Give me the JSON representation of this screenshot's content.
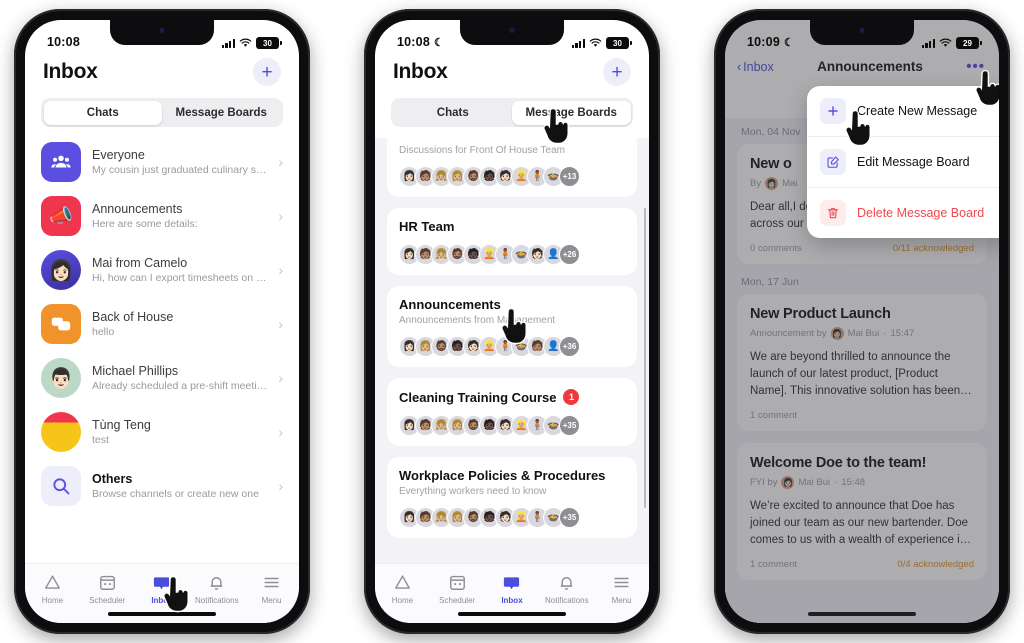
{
  "phone1": {
    "status": {
      "time": "10:08",
      "battery": "30",
      "signal_icon": "cellular-signal-icon",
      "wifi_icon": "wifi-icon"
    },
    "header": {
      "title": "Inbox",
      "add_label": "+"
    },
    "tabs": [
      {
        "label": "Chats",
        "active": true
      },
      {
        "label": "Message Boards",
        "active": false
      }
    ],
    "chats": [
      {
        "name": "Everyone",
        "snippet": "My cousin just graduated culinary schoo...",
        "avatar": "group-icon",
        "color": "#5a4fe0",
        "emoji": "👥"
      },
      {
        "name": "Announcements",
        "snippet": "Here are some details:",
        "avatar": "megaphone-icon",
        "color": "#f0354f",
        "emoji": "📣"
      },
      {
        "name": "Mai from Camelo",
        "snippet": "Hi, how can I export timesheets on the ...",
        "avatar": "user-photo",
        "color": "#5a4fe0",
        "emoji": "👩"
      },
      {
        "name": "Back of House",
        "snippet": "hello",
        "avatar": "chat-bubbles-icon",
        "color": "#f0932b",
        "emoji": "💬"
      },
      {
        "name": "Michael Phillips",
        "snippet": "Already scheduled a pre-shift meeting f...",
        "avatar": "user-photo",
        "color": "#bcd9c8",
        "emoji": "👨"
      },
      {
        "name": "Tùng Teng",
        "snippet": "test",
        "avatar": "user-photo",
        "color": "#f5c518",
        "emoji": ""
      },
      {
        "name": "Others",
        "snippet": "Browse channels or create new one",
        "avatar": "search-icon",
        "color": "#eeeefb",
        "emoji": "🔍"
      }
    ],
    "navbar": [
      {
        "label": "Home",
        "icon": "home-icon",
        "active": false
      },
      {
        "label": "Scheduler",
        "icon": "calendar-icon",
        "active": false
      },
      {
        "label": "Inbox",
        "icon": "inbox-bubble-icon",
        "active": true
      },
      {
        "label": "Notifications",
        "icon": "bell-icon",
        "active": false
      },
      {
        "label": "Menu",
        "icon": "hamburger-icon",
        "active": false
      }
    ]
  },
  "phone2": {
    "status": {
      "time": "10:08",
      "moon": "☾",
      "battery": "30"
    },
    "header": {
      "title": "Inbox",
      "add_label": "+"
    },
    "tabs": [
      {
        "label": "Chats",
        "active": false
      },
      {
        "label": "Message Boards",
        "active": true
      }
    ],
    "boards": [
      {
        "title": "",
        "subtitle": "Discussions for Front Of House Team",
        "more_count": "+13",
        "badge": "",
        "clipped": true
      },
      {
        "title": "HR Team",
        "subtitle": "",
        "more_count": "+26",
        "badge": "",
        "clipped": false
      },
      {
        "title": "Announcements",
        "subtitle": "Announcements from Management",
        "more_count": "+36",
        "badge": "",
        "clipped": false
      },
      {
        "title": "Cleaning Training Course",
        "subtitle": "",
        "more_count": "+35",
        "badge": "1",
        "clipped": false
      },
      {
        "title": "Workplace Policies & Procedures",
        "subtitle": "Everything workers need to know",
        "more_count": "+35",
        "badge": "",
        "clipped": false
      }
    ],
    "navbar": [
      {
        "label": "Home",
        "icon": "home-icon",
        "active": false
      },
      {
        "label": "Scheduler",
        "icon": "calendar-icon",
        "active": false
      },
      {
        "label": "Inbox",
        "icon": "inbox-bubble-icon",
        "active": true
      },
      {
        "label": "Notifications",
        "icon": "bell-icon",
        "active": false
      },
      {
        "label": "Menu",
        "icon": "hamburger-icon",
        "active": false
      }
    ]
  },
  "phone3": {
    "status": {
      "time": "10:09",
      "moon": "☾",
      "battery": "29"
    },
    "header": {
      "back_label": "Inbox",
      "title": "Announcements",
      "dots_label": "•••"
    },
    "menu": [
      {
        "label": "Create New Message",
        "icon": "plus-icon",
        "danger": false
      },
      {
        "label": "Edit Message Board",
        "icon": "edit-square-icon",
        "danger": false
      },
      {
        "label": "Delete Message Board",
        "icon": "trash-icon",
        "danger": true
      }
    ],
    "groups": [
      {
        "day": "Mon, 04 Nov",
        "posts": [
          {
            "title": "New o",
            "meta_prefix": "By",
            "author": "Mai",
            "time": "",
            "body": "Dear all,I development probably came across our latest job openi…",
            "comments": "0 comments",
            "ack": "0/11 acknowledged"
          }
        ]
      },
      {
        "day": "Mon, 17 Jun",
        "posts": [
          {
            "title": "New Product Launch",
            "meta_prefix": "Announcement by",
            "author": "Mai Bui",
            "time": "15:47",
            "body": "We are beyond thrilled to announce the launch of our latest product, [Product Name]. This innovative solution has been…",
            "comments": "1 comment",
            "ack": ""
          },
          {
            "title": "Welcome Doe to the team!",
            "meta_prefix": "FYI by",
            "author": "Mai Bui",
            "time": "15:48",
            "body": "We’re excited to announce that Doe has joined our team as our new bartender. Doe comes to us with a wealth of experience i…",
            "comments": "1 comment",
            "ack": "0/4 acknowledged"
          }
        ]
      }
    ]
  },
  "colors": {
    "accent": "#4b4ddb",
    "danger": "#f0494f",
    "ack": "#e0952a",
    "badge": "#f0393f",
    "page_bg": "#f2f2f7"
  }
}
